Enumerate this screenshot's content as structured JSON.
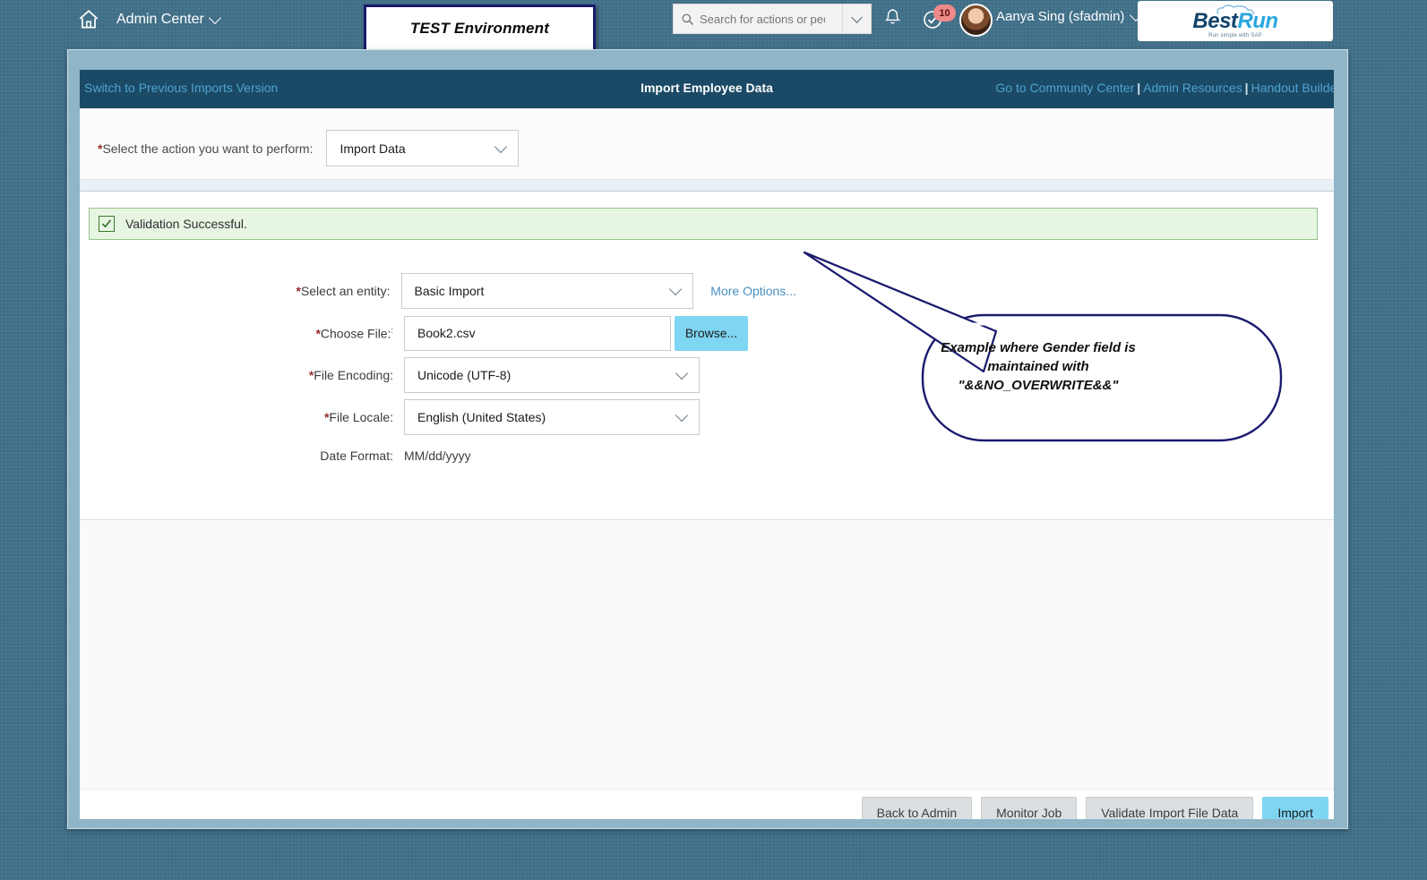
{
  "shell": {
    "home_icon": "home-icon",
    "menu_label": "Admin Center",
    "test_environment_label": "TEST Environment",
    "search": {
      "placeholder": "Search for actions or people",
      "value": "",
      "icon": "search-icon",
      "dropdown_icon": "chevron-down-icon"
    },
    "bell_icon": "bell-icon",
    "approvals": {
      "icon": "check-circle-icon",
      "badge_count": "10"
    },
    "user": {
      "avatar": "user-avatar",
      "name": "Aanya Sing (sfadmin)",
      "dropdown_icon": "chevron-down-icon"
    },
    "brand": {
      "name_part1": "Best",
      "name_part2": "Run",
      "tagline": "Run simple with SAP",
      "cloud_icon": "cloud-icon"
    }
  },
  "toolbar": {
    "switch_link": "Switch to Previous Imports Version",
    "title": "Import Employee Data",
    "links": [
      "Go to Community Center",
      "Admin Resources",
      "Handout Builder"
    ],
    "separator": "|"
  },
  "action_band": {
    "label": "Select the action you want to perform:",
    "required_marker": "*",
    "selected_value": "Import Data",
    "dropdown_icon": "chevron-down-icon"
  },
  "message": {
    "icon": "checkbox-checked-icon",
    "text": "Validation Successful."
  },
  "form": {
    "entity": {
      "label": "Select an entity:",
      "required_marker": "*",
      "value": "Basic Import",
      "dropdown_icon": "chevron-down-icon",
      "more_options_link": "More Options..."
    },
    "file": {
      "label": "Choose File:",
      "label_sup": ":",
      "required_marker": "*",
      "value": "Book2.csv",
      "browse_label": "Browse..."
    },
    "encoding": {
      "label": "File Encoding:",
      "required_marker": "*",
      "value": "Unicode (UTF-8)",
      "dropdown_icon": "chevron-down-icon"
    },
    "locale": {
      "label": "File Locale:",
      "required_marker": "*",
      "value": "English (United States)",
      "dropdown_icon": "chevron-down-icon"
    },
    "date_format": {
      "label": "Date Format:",
      "value": "MM/dd/yyyy"
    }
  },
  "footer": {
    "buttons": [
      "Back to Admin",
      "Monitor Job",
      "Validate Import File Data",
      "Import"
    ]
  },
  "callout": {
    "text": "Example where Gender field is maintained with \"&&NO_OVERWRITE&&\""
  },
  "colors": {
    "desktop_background": "#42718a",
    "toolbar": "#1b4a66",
    "link": "#4ea3cf",
    "required": "#9b2c2c",
    "success_bg": "#e7f5e3",
    "success_border": "#96c48a",
    "primary_button": "#7fd6f2",
    "callout_outline": "#1a1a6e",
    "brand_blue": "#2aa7e0"
  }
}
